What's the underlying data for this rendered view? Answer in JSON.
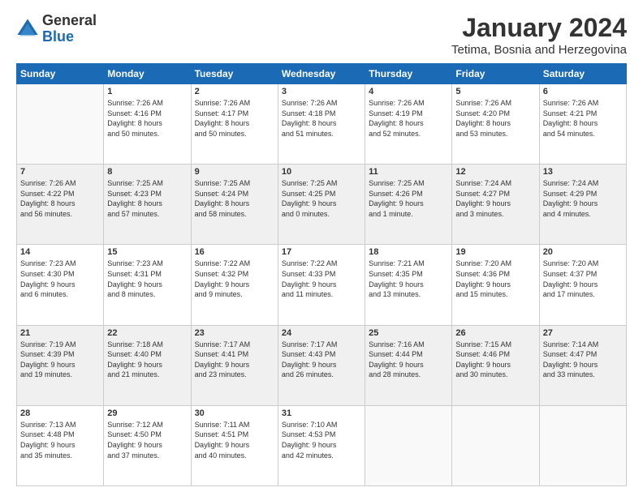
{
  "logo": {
    "general": "General",
    "blue": "Blue"
  },
  "title": "January 2024",
  "location": "Tetima, Bosnia and Herzegovina",
  "days_header": [
    "Sunday",
    "Monday",
    "Tuesday",
    "Wednesday",
    "Thursday",
    "Friday",
    "Saturday"
  ],
  "weeks": [
    [
      {
        "day": "",
        "info": ""
      },
      {
        "day": "1",
        "info": "Sunrise: 7:26 AM\nSunset: 4:16 PM\nDaylight: 8 hours\nand 50 minutes."
      },
      {
        "day": "2",
        "info": "Sunrise: 7:26 AM\nSunset: 4:17 PM\nDaylight: 8 hours\nand 50 minutes."
      },
      {
        "day": "3",
        "info": "Sunrise: 7:26 AM\nSunset: 4:18 PM\nDaylight: 8 hours\nand 51 minutes."
      },
      {
        "day": "4",
        "info": "Sunrise: 7:26 AM\nSunset: 4:19 PM\nDaylight: 8 hours\nand 52 minutes."
      },
      {
        "day": "5",
        "info": "Sunrise: 7:26 AM\nSunset: 4:20 PM\nDaylight: 8 hours\nand 53 minutes."
      },
      {
        "day": "6",
        "info": "Sunrise: 7:26 AM\nSunset: 4:21 PM\nDaylight: 8 hours\nand 54 minutes."
      }
    ],
    [
      {
        "day": "7",
        "info": "Sunrise: 7:26 AM\nSunset: 4:22 PM\nDaylight: 8 hours\nand 56 minutes."
      },
      {
        "day": "8",
        "info": "Sunrise: 7:25 AM\nSunset: 4:23 PM\nDaylight: 8 hours\nand 57 minutes."
      },
      {
        "day": "9",
        "info": "Sunrise: 7:25 AM\nSunset: 4:24 PM\nDaylight: 8 hours\nand 58 minutes."
      },
      {
        "day": "10",
        "info": "Sunrise: 7:25 AM\nSunset: 4:25 PM\nDaylight: 9 hours\nand 0 minutes."
      },
      {
        "day": "11",
        "info": "Sunrise: 7:25 AM\nSunset: 4:26 PM\nDaylight: 9 hours\nand 1 minute."
      },
      {
        "day": "12",
        "info": "Sunrise: 7:24 AM\nSunset: 4:27 PM\nDaylight: 9 hours\nand 3 minutes."
      },
      {
        "day": "13",
        "info": "Sunrise: 7:24 AM\nSunset: 4:29 PM\nDaylight: 9 hours\nand 4 minutes."
      }
    ],
    [
      {
        "day": "14",
        "info": "Sunrise: 7:23 AM\nSunset: 4:30 PM\nDaylight: 9 hours\nand 6 minutes."
      },
      {
        "day": "15",
        "info": "Sunrise: 7:23 AM\nSunset: 4:31 PM\nDaylight: 9 hours\nand 8 minutes."
      },
      {
        "day": "16",
        "info": "Sunrise: 7:22 AM\nSunset: 4:32 PM\nDaylight: 9 hours\nand 9 minutes."
      },
      {
        "day": "17",
        "info": "Sunrise: 7:22 AM\nSunset: 4:33 PM\nDaylight: 9 hours\nand 11 minutes."
      },
      {
        "day": "18",
        "info": "Sunrise: 7:21 AM\nSunset: 4:35 PM\nDaylight: 9 hours\nand 13 minutes."
      },
      {
        "day": "19",
        "info": "Sunrise: 7:20 AM\nSunset: 4:36 PM\nDaylight: 9 hours\nand 15 minutes."
      },
      {
        "day": "20",
        "info": "Sunrise: 7:20 AM\nSunset: 4:37 PM\nDaylight: 9 hours\nand 17 minutes."
      }
    ],
    [
      {
        "day": "21",
        "info": "Sunrise: 7:19 AM\nSunset: 4:39 PM\nDaylight: 9 hours\nand 19 minutes."
      },
      {
        "day": "22",
        "info": "Sunrise: 7:18 AM\nSunset: 4:40 PM\nDaylight: 9 hours\nand 21 minutes."
      },
      {
        "day": "23",
        "info": "Sunrise: 7:17 AM\nSunset: 4:41 PM\nDaylight: 9 hours\nand 23 minutes."
      },
      {
        "day": "24",
        "info": "Sunrise: 7:17 AM\nSunset: 4:43 PM\nDaylight: 9 hours\nand 26 minutes."
      },
      {
        "day": "25",
        "info": "Sunrise: 7:16 AM\nSunset: 4:44 PM\nDaylight: 9 hours\nand 28 minutes."
      },
      {
        "day": "26",
        "info": "Sunrise: 7:15 AM\nSunset: 4:46 PM\nDaylight: 9 hours\nand 30 minutes."
      },
      {
        "day": "27",
        "info": "Sunrise: 7:14 AM\nSunset: 4:47 PM\nDaylight: 9 hours\nand 33 minutes."
      }
    ],
    [
      {
        "day": "28",
        "info": "Sunrise: 7:13 AM\nSunset: 4:48 PM\nDaylight: 9 hours\nand 35 minutes."
      },
      {
        "day": "29",
        "info": "Sunrise: 7:12 AM\nSunset: 4:50 PM\nDaylight: 9 hours\nand 37 minutes."
      },
      {
        "day": "30",
        "info": "Sunrise: 7:11 AM\nSunset: 4:51 PM\nDaylight: 9 hours\nand 40 minutes."
      },
      {
        "day": "31",
        "info": "Sunrise: 7:10 AM\nSunset: 4:53 PM\nDaylight: 9 hours\nand 42 minutes."
      },
      {
        "day": "",
        "info": ""
      },
      {
        "day": "",
        "info": ""
      },
      {
        "day": "",
        "info": ""
      }
    ]
  ],
  "row_shading": [
    false,
    true,
    false,
    true,
    false
  ]
}
